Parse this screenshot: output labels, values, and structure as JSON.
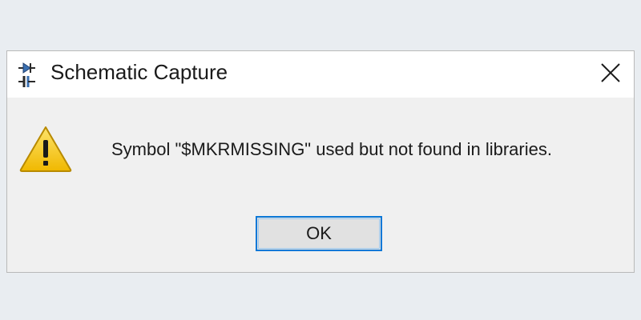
{
  "dialog": {
    "title": "Schematic Capture",
    "title_icon": "schematic-app-icon",
    "close_icon": "close-icon",
    "warning_icon": "warning-icon",
    "message": "Symbol \"$MKRMISSING\" used but not found in libraries.",
    "ok_label": "OK"
  },
  "colors": {
    "background": "#e9edf1",
    "dialog_body": "#f0f0f0",
    "titlebar": "#ffffff",
    "button_border": "#0a78d7",
    "warning_fill": "#f5c400"
  }
}
